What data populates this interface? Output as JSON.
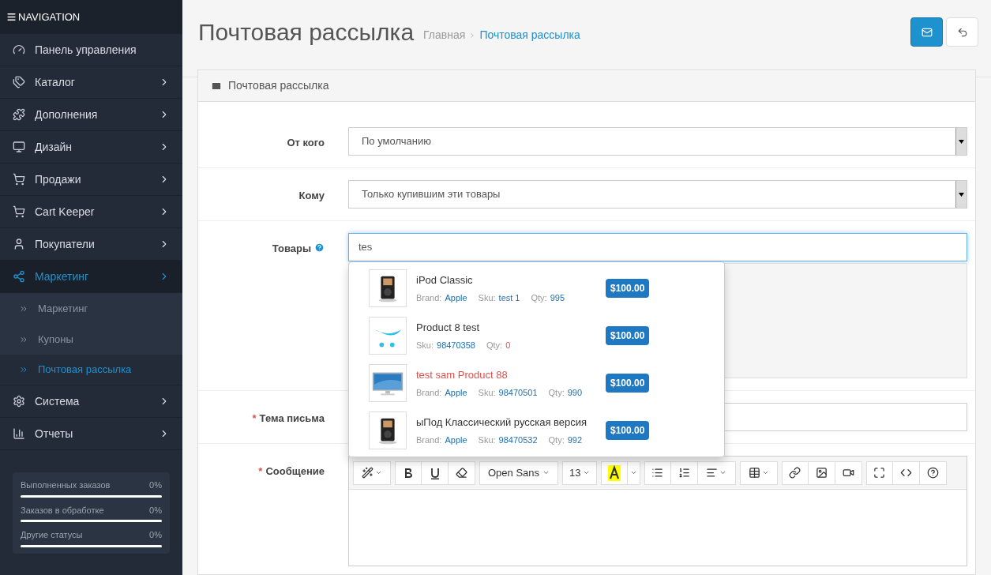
{
  "sidebar": {
    "header": "NAVIGATION",
    "items": [
      {
        "label": "Панель управления",
        "arrow": false,
        "selected": false
      },
      {
        "label": "Каталог",
        "arrow": true,
        "selected": false
      },
      {
        "label": "Дополнения",
        "arrow": true,
        "selected": false
      },
      {
        "label": "Дизайн",
        "arrow": true,
        "selected": false
      },
      {
        "label": "Продажи",
        "arrow": true,
        "selected": false
      },
      {
        "label": "Cart Keeper",
        "arrow": true,
        "selected": false
      },
      {
        "label": "Покупатели",
        "arrow": true,
        "selected": false
      },
      {
        "label": "Маркетинг",
        "arrow": true,
        "selected": true,
        "children": [
          {
            "label": "Маркетинг",
            "selected": false
          },
          {
            "label": "Купоны",
            "selected": false
          },
          {
            "label": "Почтовая рассылка",
            "selected": true
          }
        ]
      },
      {
        "label": "Система",
        "arrow": true,
        "selected": false
      },
      {
        "label": "Отчеты",
        "arrow": true,
        "selected": false
      }
    ],
    "stats": [
      {
        "label": "Выполненных заказов",
        "value": "0%",
        "level": 0
      },
      {
        "label": "Заказов в обработке",
        "value": "0%",
        "level": 0
      },
      {
        "label": "Другие статусы",
        "value": "0%",
        "level": 0
      }
    ]
  },
  "page": {
    "title": "Почтовая рассылка",
    "breadcrumbs": [
      {
        "label": "Главная",
        "selected": false
      },
      {
        "label": "Почтовая рассылка",
        "selected": true
      }
    ]
  },
  "panel": {
    "title": "Почтовая рассылка"
  },
  "form": [
    {
      "kind": "select",
      "label": "От кого",
      "help": false,
      "value": "По умолчанию"
    },
    {
      "kind": "select",
      "label": "Кому",
      "help": false,
      "value": "Только купившим эти товары"
    },
    {
      "kind": "autocomplete",
      "label": "Товары",
      "help": true,
      "value": "tes"
    },
    {
      "kind": "text",
      "label": "Тема письма",
      "required_mark": "*",
      "help": false
    },
    {
      "kind": "editor",
      "label": "Сообщение",
      "required_mark": "*",
      "help": false,
      "font": "Open Sans",
      "size": "13"
    }
  ],
  "suggestions": [
    {
      "name": "iPod Classic",
      "highlighted": false,
      "price": "$100.00",
      "meta": [
        {
          "label": "Brand:",
          "value": "Apple",
          "alert": false
        },
        {
          "label": "Sku:",
          "value": "test 1",
          "alert": false
        },
        {
          "label": "Qty:",
          "value": "995",
          "alert": false
        }
      ]
    },
    {
      "name": "Product 8 test",
      "highlighted": false,
      "price": "$100.00",
      "meta": [
        {
          "label": "Sku:",
          "value": "98470358",
          "alert": false
        },
        {
          "label": "Qty:",
          "value": "0",
          "alert": true
        }
      ]
    },
    {
      "name": "test sam Product 88",
      "highlighted": true,
      "price": "$100.00",
      "meta": [
        {
          "label": "Brand:",
          "value": "Apple",
          "alert": false
        },
        {
          "label": "Sku:",
          "value": "98470501",
          "alert": false
        },
        {
          "label": "Qty:",
          "value": "990",
          "alert": false
        }
      ]
    },
    {
      "name": "ыПод Классический русская версия",
      "highlighted": false,
      "price": "$100.00",
      "meta": [
        {
          "label": "Brand:",
          "value": "Apple",
          "alert": false
        },
        {
          "label": "Sku:",
          "value": "98470532",
          "alert": false
        },
        {
          "label": "Qty:",
          "value": "992",
          "alert": false
        }
      ]
    }
  ]
}
